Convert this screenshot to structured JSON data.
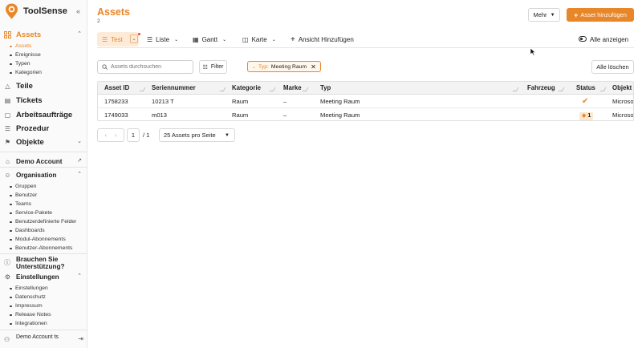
{
  "app": {
    "name": "ToolSense",
    "collapse_icon": "double-chevron-left-icon"
  },
  "colors": {
    "accent": "#e8862a",
    "accent_light": "#fdebd8",
    "border": "#d6d6d6"
  },
  "sidebar": {
    "assets": {
      "label": "Assets",
      "items": [
        "Assets",
        "Ereignisse",
        "Typen",
        "Kategorien"
      ]
    },
    "main_items": [
      "Teile",
      "Tickets",
      "Arbeitsaufträge",
      "Prozedur",
      "Objekte"
    ],
    "account": "Demo Account",
    "organisation": {
      "label": "Organisation",
      "items": [
        "Gruppen",
        "Benutzer",
        "Teams",
        "Service-Pakete",
        "Benutzerdefinierte Felder",
        "Dashboards",
        "Modul-Abonnements",
        "Benutzer-Abonnements"
      ]
    },
    "support": {
      "line1": "Brauchen Sie",
      "line2": "Unterstützung?"
    },
    "settings": {
      "label": "Einstellungen",
      "items": [
        "Einstellungen",
        "Datenschutz",
        "Impressum",
        "Release Notes",
        "Integrationen"
      ]
    },
    "user": {
      "name": "Demo Account ts"
    }
  },
  "header": {
    "title": "Assets",
    "count": "2",
    "more_label": "Mehr",
    "add_label": "Asset hinzufügen"
  },
  "views": {
    "tabs": [
      {
        "label": "Test",
        "active": true
      },
      {
        "label": "Liste"
      },
      {
        "label": "Gantt"
      },
      {
        "label": "Karte"
      }
    ],
    "add_view": "Ansicht Hinzufügen",
    "show_all": "Alle anzeigen"
  },
  "filters": {
    "search_placeholder": "Assets durchsuchen",
    "filter_label": "Filter",
    "chip_key": "Typ:",
    "chip_value": "Meeting Raum",
    "clear_all": "Alle löschen"
  },
  "table": {
    "columns": [
      "Asset ID",
      "Seriennummer",
      "Kategorie",
      "Marke",
      "Typ",
      "Fahrzeug",
      "Status",
      "Objekt"
    ],
    "rows": [
      {
        "asset_id": "1758233",
        "serial": "10213 T",
        "category": "Raum",
        "brand": "–",
        "type": "Meeting Raum",
        "vehicle": "",
        "status": "check",
        "object": "Microso"
      },
      {
        "asset_id": "1749033",
        "serial": "m013",
        "category": "Raum",
        "brand": "–",
        "type": "Meeting Raum",
        "vehicle": "",
        "status": "1",
        "object": "Microso"
      }
    ]
  },
  "pagination": {
    "current_page": "1",
    "total_pages": "/ 1",
    "per_page": "25 Assets pro Seite"
  }
}
